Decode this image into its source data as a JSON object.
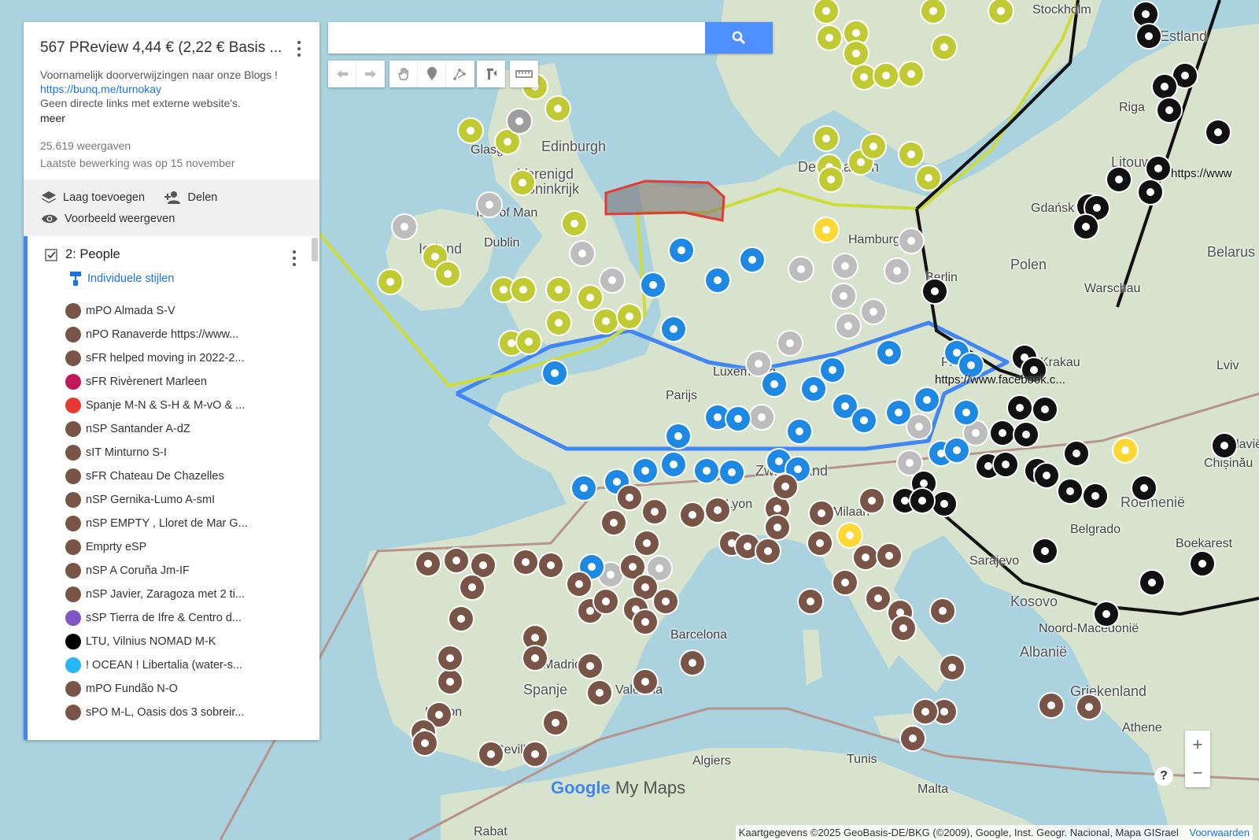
{
  "map": {
    "title": "567 PReview 4,44 € (2,22 € Basis ...",
    "description": "Voornamelijk doorverwijzingen naar onze Blogs !",
    "link": "https://bunq.me/turnokay",
    "note": "Geen directe links met externe website's.",
    "more": "meer",
    "views": "25.619 weergaven",
    "last_edit": "Laatste bewerking was op 15 november"
  },
  "actions": {
    "add_layer": "Laag toevoegen",
    "share": "Delen",
    "preview": "Voorbeeld weergeven"
  },
  "layer": {
    "title": "2: People",
    "styles_link": "Individuele stijlen",
    "items": [
      {
        "label": "mPO Almada S-V",
        "icon": "person-icon",
        "color": "#795548"
      },
      {
        "label": "nPO Ranaverde https://www...",
        "icon": "group-icon",
        "color": "#795548"
      },
      {
        "label": "sFR helped moving in 2022-2...",
        "icon": "horse-icon",
        "color": "#795548"
      },
      {
        "label": "sFR Rivèrenert Marleen",
        "icon": "runner-icon",
        "color": "#c2185b"
      },
      {
        "label": "Spanje M-N & S-H & M-vO & ...",
        "icon": "spain-flag-icon",
        "color": "#e53935"
      },
      {
        "label": "nSP Santander A-dZ",
        "icon": "person-icon",
        "color": "#795548"
      },
      {
        "label": "sIT Minturno S-I",
        "icon": "person-icon",
        "color": "#795548"
      },
      {
        "label": "sFR Chateau De Chazelles",
        "icon": "question-icon",
        "color": "#795548"
      },
      {
        "label": "nSP Gernika-Lumo A-smI",
        "icon": "brain-icon",
        "color": "#795548"
      },
      {
        "label": "nSP EMPTY , Lloret de Mar G...",
        "icon": "xxx-icon",
        "color": "#795548"
      },
      {
        "label": "Emprty eSP",
        "icon": "xxx-icon",
        "color": "#795548"
      },
      {
        "label": "nSP A Coruña Jm-IF",
        "icon": "person-icon",
        "color": "#795548"
      },
      {
        "label": "nSP Javier, Zaragoza met 2 ti...",
        "icon": "person-icon",
        "color": "#795548"
      },
      {
        "label": "sSP Tierra de Ifre & Centro d...",
        "icon": "house-icon",
        "color": "#7e57c2"
      },
      {
        "label": "LTU, Vilnius NOMAD  M-K",
        "icon": "person-icon",
        "color": "#000000"
      },
      {
        "label": "! OCEAN ! Libertalia  (water-s...",
        "icon": "ship-icon",
        "color": "#29b6f6"
      },
      {
        "label": "mPO Fundão N-O",
        "icon": "person-icon",
        "color": "#795548"
      },
      {
        "label": "sPO M-L, Oasis dos 3 sobreir...",
        "icon": "question-icon",
        "color": "#795548"
      }
    ]
  },
  "search": {
    "placeholder": ""
  },
  "map_labels": [
    {
      "text": "Edinburgh"
    },
    {
      "text": "Verenigd"
    },
    {
      "text": "Koninkrijk"
    },
    {
      "text": "Isle of Man"
    },
    {
      "text": "Dublin"
    },
    {
      "text": "Ierland"
    },
    {
      "text": "Glasg"
    },
    {
      "text": "Parijs"
    },
    {
      "text": "Lyon"
    },
    {
      "text": "Milaan"
    },
    {
      "text": "Barcelona"
    },
    {
      "text": "Madrid"
    },
    {
      "text": "Spanje"
    },
    {
      "text": "Valencia"
    },
    {
      "text": "Lisbon"
    },
    {
      "text": "Sevilla"
    },
    {
      "text": "Algiers"
    },
    {
      "text": "Tunis"
    },
    {
      "text": "Malta"
    },
    {
      "text": "Rabat"
    },
    {
      "text": "Sarajevo"
    },
    {
      "text": "Kosovo"
    },
    {
      "text": "Albanië"
    },
    {
      "text": "Noord-Macedonië"
    },
    {
      "text": "Griekenland"
    },
    {
      "text": "Athene"
    },
    {
      "text": "Boekarest"
    },
    {
      "text": "Roemenië"
    },
    {
      "text": "Belgrado"
    },
    {
      "text": "Krakau"
    },
    {
      "text": "Warschau"
    },
    {
      "text": "Polen"
    },
    {
      "text": "Gdańsk"
    },
    {
      "text": "Litouwen"
    },
    {
      "text": "Riga"
    },
    {
      "text": "Estland"
    },
    {
      "text": "Belarus"
    },
    {
      "text": "Lviv"
    },
    {
      "text": "Moldavië"
    },
    {
      "text": "Chișinău"
    },
    {
      "text": "Hamburg"
    },
    {
      "text": "Berlin"
    },
    {
      "text": "Denemarken"
    },
    {
      "text": "Stockholm"
    },
    {
      "text": "Luxemburg"
    },
    {
      "text": "Praag"
    },
    {
      "text": "Zwitserland"
    }
  ],
  "overlay_text": {
    "facebook_url": "https://www.facebook.c...",
    "other_url": "https://www"
  },
  "branding": {
    "logo_google": "Google",
    "logo_suffix": "My Maps"
  },
  "attribution": {
    "text": "Kaartgegevens ©2025 GeoBasis-DE/BKG (©2009), Google, Inst. Geogr. Nacional, Mapa GISrael",
    "terms": "Voorwaarden"
  },
  "zoom": {
    "in": "+",
    "out": "−"
  },
  "help": "?"
}
